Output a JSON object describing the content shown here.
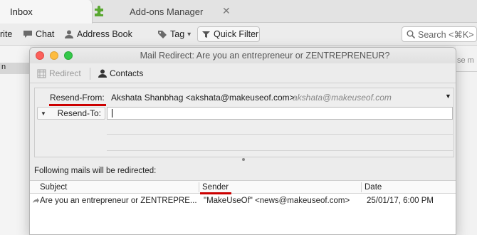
{
  "tabs": {
    "inbox": "Inbox",
    "addons": "Add-ons Manager",
    "close_glyph": "✕"
  },
  "toolbar": {
    "write_fragment": "rite",
    "chat": "Chat",
    "address_book": "Address Book",
    "tag": "Tag",
    "tag_arrow": "▾",
    "quick_filter": "Quick Filter",
    "search_placeholder": "Search <⌘K>"
  },
  "background": {
    "left_row_fragment": "n",
    "right_fragment": "se m"
  },
  "dialog": {
    "title": "Mail Redirect: Are you an entrepreneur or ZENTREPRENEUR?",
    "toolbar": {
      "redirect": "Redirect",
      "contacts": "Contacts"
    },
    "resend_from": {
      "label": "Resend-From:",
      "value": "Akshata Shanbhag <akshata@makeuseof.com>",
      "hint": "akshata@makeuseof.com"
    },
    "resend_to": {
      "label": "Resend-To:",
      "value": ""
    },
    "info": "Following mails will be redirected:",
    "columns": [
      "Subject",
      "Sender",
      "Date"
    ],
    "rows": [
      {
        "subject": "Are you an entrepreneur or ZENTREPRE...",
        "sender": "\"MakeUseOf\" <news@makeuseof.com>",
        "date": "25/01/17, 6:00 PM"
      }
    ]
  },
  "colors": {
    "annotation_red": "#cc0000",
    "close": "#fc605b",
    "minimize": "#fdbc40",
    "zoom": "#34c84a"
  }
}
